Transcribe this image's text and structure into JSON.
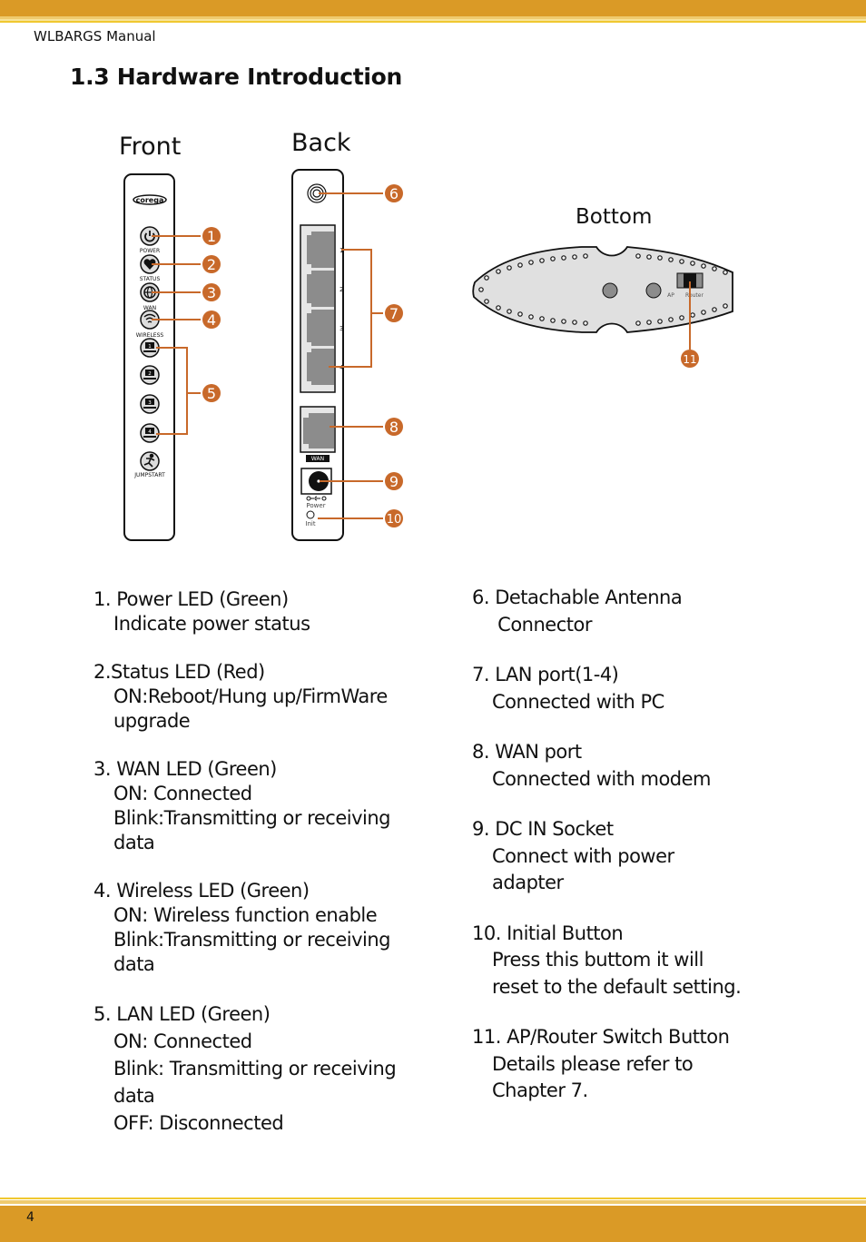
{
  "header": {
    "manual_title": "WLBARGS Manual"
  },
  "section": {
    "title": "1.3 Hardware Introduction"
  },
  "footer": {
    "page_number": "4"
  },
  "colors": {
    "band": "#da9a26",
    "callout": "#c8692a",
    "stripe_light": "#efca6e",
    "stripe_yellow": "#f0c830"
  },
  "diagrams": {
    "front": {
      "label": "Front",
      "brand": "corega",
      "leds": [
        {
          "label": "POWER",
          "icon": "power-icon",
          "callout": "1"
        },
        {
          "label": "STATUS",
          "icon": "heart-icon",
          "callout": "2"
        },
        {
          "label": "WAN",
          "icon": "globe-icon",
          "callout": "3"
        },
        {
          "label": "WIRELESS",
          "icon": "wifi-icon",
          "callout": "4"
        }
      ],
      "lan_leds": [
        "1",
        "2",
        "3",
        "4"
      ],
      "lan_callout": "5",
      "jumpstart_label": "JUMPSTART"
    },
    "back": {
      "label": "Back",
      "antenna_callout": "6",
      "lan_port_numbers": [
        "1",
        "2",
        "3",
        "4"
      ],
      "lan_callout": "7",
      "wan_label": "WAN",
      "wan_callout": "8",
      "power_label": "Power",
      "power_callout": "9",
      "init_label": "Init",
      "init_callout": "10"
    },
    "bottom": {
      "label": "Bottom",
      "switch_left_label": "AP",
      "switch_right_label": "Router",
      "switch_callout": "11"
    }
  },
  "descriptions": {
    "left": [
      {
        "title": "1. Power LED (Green)",
        "lines": [
          "Indicate power status"
        ]
      },
      {
        "title": "2.Status LED (Red)",
        "lines": [
          "ON:Reboot/Hung up/FirmWare",
          "upgrade"
        ]
      },
      {
        "title": "3. WAN LED (Green)",
        "lines": [
          "ON: Connected",
          "Blink:Transmitting or receiving",
          "data"
        ]
      },
      {
        "title": "4. Wireless LED (Green)",
        "lines": [
          "ON: Wireless function enable",
          "Blink:Transmitting or receiving",
          "data"
        ]
      },
      {
        "title": "5. LAN LED (Green)",
        "lines": [
          "ON: Connected",
          "Blink: Transmitting or receiving",
          "data",
          "OFF: Disconnected"
        ]
      }
    ],
    "right": [
      {
        "title": "6. Detachable Antenna",
        "lines": [
          " Connector"
        ]
      },
      {
        "title": "7. LAN port(1-4)",
        "lines": [
          "Connected with PC"
        ]
      },
      {
        "title": "8. WAN port",
        "lines": [
          "Connected with modem"
        ]
      },
      {
        "title": "9. DC IN Socket",
        "lines": [
          "Connect with power",
          "adapter"
        ]
      },
      {
        "title": "10. Initial Button",
        "lines": [
          "Press this buttom it will",
          "reset to the default setting."
        ]
      },
      {
        "title": "11. AP/Router Switch Button",
        "lines": [
          "Details please refer to",
          "Chapter 7."
        ]
      }
    ]
  }
}
